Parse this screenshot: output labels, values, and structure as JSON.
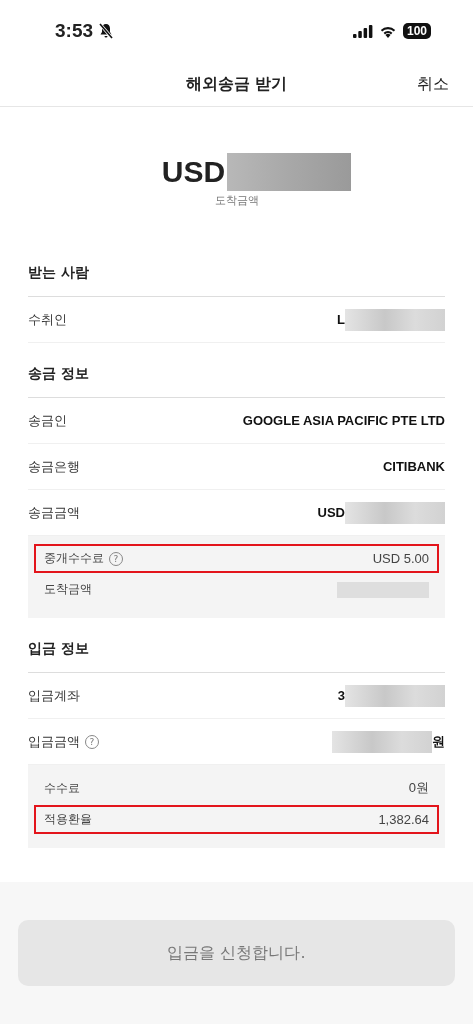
{
  "status_bar": {
    "time": "3:53",
    "muted": true,
    "battery": "100"
  },
  "header": {
    "title": "해외송금 받기",
    "cancel": "취소"
  },
  "amount": {
    "currency": "USD",
    "redacted": true,
    "caption": "도착금액"
  },
  "sections": [
    {
      "title": "받는 사람",
      "rows": [
        {
          "label": "수취인",
          "value": "L",
          "masked_after": true
        }
      ]
    },
    {
      "title": "송금 정보",
      "rows": [
        {
          "label": "송금인",
          "value": "GOOGLE ASIA PACIFIC PTE LTD"
        },
        {
          "label": "송금은행",
          "value": "CITIBANK"
        },
        {
          "label": "송금금액",
          "value": "USD",
          "masked_after": true
        }
      ],
      "details": [
        {
          "label": "중개수수료",
          "help": "?",
          "value": "USD 5.00",
          "highlighted": true
        },
        {
          "label": "도착금액",
          "masked_before": true,
          "highlighted": false
        }
      ]
    },
    {
      "title": "입금 정보",
      "rows": [
        {
          "label": "입금계좌",
          "value": "3",
          "masked_after": true
        },
        {
          "label": "입금금액",
          "help": "?",
          "value": "원",
          "masked_before": true
        }
      ],
      "details": [
        {
          "label": "수수료",
          "value": "0원",
          "highlighted": false
        },
        {
          "label": "적용환율",
          "value": "1,382.64",
          "highlighted": true
        }
      ]
    }
  ],
  "submit": {
    "label": "입금을 신청합니다.",
    "disabled": true
  }
}
